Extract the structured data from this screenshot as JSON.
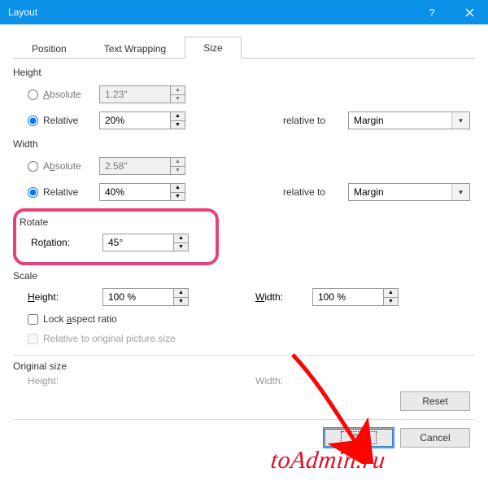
{
  "window": {
    "title": "Layout"
  },
  "tabs": {
    "position": "Position",
    "wrapping": "Text Wrapping",
    "size": "Size"
  },
  "height": {
    "section": "Height",
    "absolute_label": "Absolute",
    "absolute_value": "1.23\"",
    "relative_label": "Relative",
    "relative_value": "20%",
    "relative_to_label": "relative to",
    "relative_to_value": "Margin"
  },
  "width": {
    "section": "Width",
    "absolute_label": "Absolute",
    "absolute_value": "2.58\"",
    "relative_label": "Relative",
    "relative_value": "40%",
    "relative_to_label": "relative to",
    "relative_to_value": "Margin"
  },
  "rotate": {
    "section": "Rotate",
    "rotation_label": "Rotation:",
    "rotation_value": "45°"
  },
  "scale": {
    "section": "Scale",
    "height_label": "Height:",
    "height_value": "100 %",
    "width_label": "Width:",
    "width_value": "100 %",
    "lock_label": "Lock aspect ratio",
    "relative_orig_label": "Relative to original picture size"
  },
  "original": {
    "section": "Original size",
    "height_label": "Height:",
    "width_label": "Width:"
  },
  "buttons": {
    "reset": "Reset",
    "ok": "OK",
    "cancel": "Cancel"
  },
  "watermark": "toAdmin.ru"
}
